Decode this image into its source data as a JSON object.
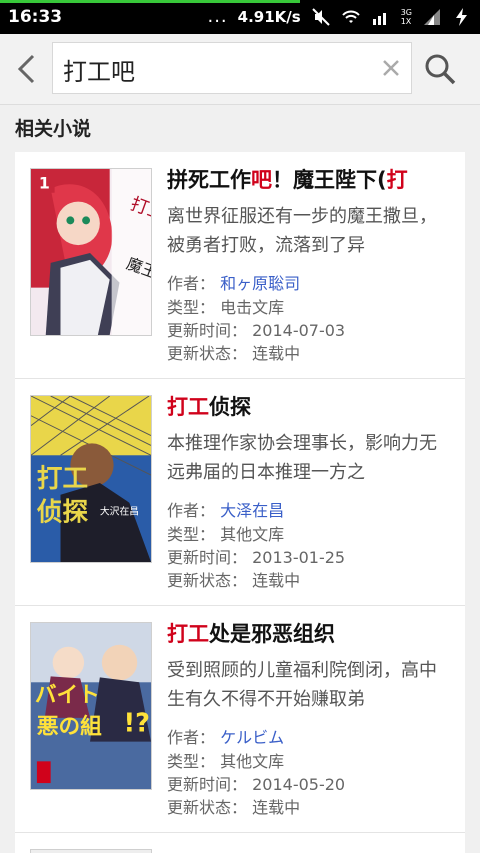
{
  "status_bar": {
    "time": "16:33",
    "dots": "...",
    "speed": "4.91K/s",
    "net_top": "3G",
    "net_bottom": "1X",
    "accent_color": "#38c83a"
  },
  "search": {
    "query": "打工吧",
    "back_icon": "back-chevron-icon",
    "clear_icon": "close-icon",
    "search_icon": "search-icon"
  },
  "section": {
    "title": "相关小说"
  },
  "labels": {
    "author": "作者：",
    "type": "类型：",
    "updated": "更新时间：",
    "state": "更新状态："
  },
  "highlight_color": "#d0021b",
  "link_color": "#3a5fc8",
  "novels": [
    {
      "title_pre": "拼死工作",
      "title_hl": "吧",
      "title_post": "！魔王陛下(",
      "title_hl2": "打",
      "desc": "离世界征服还有一步的魔王撒旦，被勇者打败，流落到了异",
      "author": "和ヶ原聡司",
      "type": "电击文库",
      "updated": "2014-07-03",
      "state": "连载中"
    },
    {
      "title_pre": "",
      "title_hl": "打工",
      "title_post": "侦探",
      "title_hl2": "",
      "desc": "本推理作家协会理事长，影响力无远弗届的日本推理一方之",
      "author": "大泽在昌",
      "type": "其他文库",
      "updated": "2013-01-25",
      "state": "连载中"
    },
    {
      "title_pre": "",
      "title_hl": "打工",
      "title_post": "处是邪恶组织",
      "title_hl2": "",
      "desc": "受到照顾的儿童福利院倒闭，高中生有久不得不开始赚取弟",
      "author": "ケルビム",
      "type": "其他文库",
      "updated": "2014-05-20",
      "state": "连载中"
    }
  ]
}
